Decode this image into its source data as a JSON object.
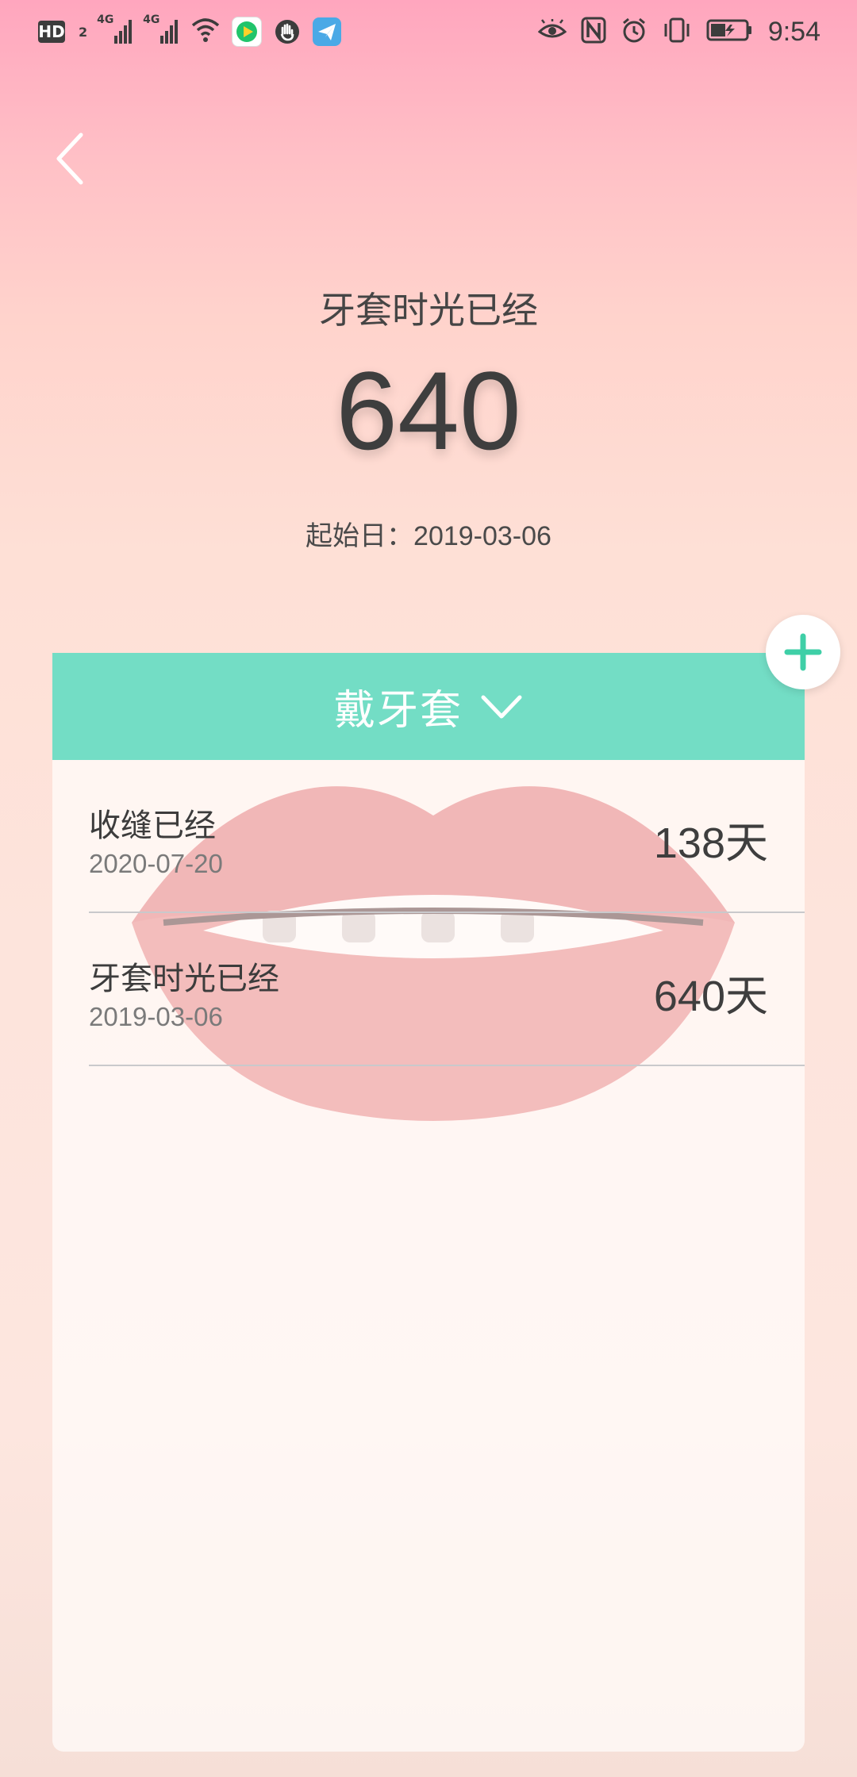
{
  "status_bar": {
    "hd_label": "HD",
    "hd_sub": "2",
    "sim1_label": "4G",
    "sim2_label": "4G",
    "time": "9:54"
  },
  "header": {
    "title": "牙套时光已经",
    "count": "640",
    "start_label": "起始日：",
    "start_date": "2019-03-06"
  },
  "card": {
    "header_label": "戴牙套",
    "rows": [
      {
        "label": "收缝已经",
        "date": "2020-07-20",
        "days": "138",
        "unit": "天"
      },
      {
        "label": "牙套时光已经",
        "date": "2019-03-06",
        "days": "640",
        "unit": "天"
      }
    ]
  },
  "colors": {
    "accent": "#73ddc5",
    "fab_plus": "#3fcfa7",
    "text_dark": "#3e3e3e"
  },
  "icons": [
    "back-arrow-icon",
    "chevron-down-icon",
    "plus-icon",
    "wifi-icon",
    "eye-icon",
    "nfc-icon",
    "alarm-icon",
    "vibrate-icon",
    "battery-icon"
  ]
}
